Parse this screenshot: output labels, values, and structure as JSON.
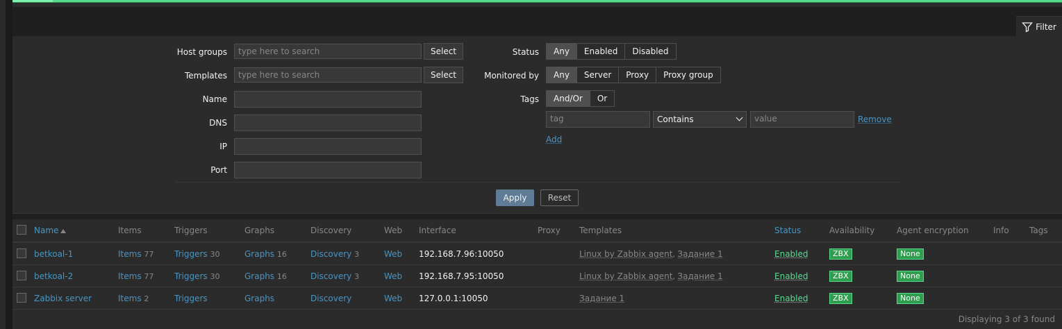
{
  "filter_tab": {
    "label": "Filter",
    "icon": "filter-icon"
  },
  "filter": {
    "host_groups": {
      "label": "Host groups",
      "placeholder": "type here to search",
      "select": "Select"
    },
    "templates": {
      "label": "Templates",
      "placeholder": "type here to search",
      "select": "Select"
    },
    "name": {
      "label": "Name",
      "value": ""
    },
    "dns": {
      "label": "DNS",
      "value": ""
    },
    "ip": {
      "label": "IP",
      "value": ""
    },
    "port": {
      "label": "Port",
      "value": ""
    },
    "status": {
      "label": "Status",
      "options": [
        "Any",
        "Enabled",
        "Disabled"
      ],
      "selected": "Any"
    },
    "monitored_by": {
      "label": "Monitored by",
      "options": [
        "Any",
        "Server",
        "Proxy",
        "Proxy group"
      ],
      "selected": "Any"
    },
    "tags": {
      "label": "Tags",
      "options": [
        "And/Or",
        "Or"
      ],
      "selected": "And/Or",
      "row": {
        "tag_placeholder": "tag",
        "operator": "Contains",
        "value_placeholder": "value",
        "remove": "Remove"
      },
      "add": "Add"
    },
    "apply": "Apply",
    "reset": "Reset"
  },
  "table": {
    "headers": {
      "name": "Name",
      "items": "Items",
      "triggers": "Triggers",
      "graphs": "Graphs",
      "discovery": "Discovery",
      "web": "Web",
      "interface": "Interface",
      "proxy": "Proxy",
      "templates": "Templates",
      "status": "Status",
      "availability": "Availability",
      "agent_encryption": "Agent encryption",
      "info": "Info",
      "tags": "Tags"
    },
    "rows": [
      {
        "name": "betkoal-1",
        "items": "Items",
        "items_count": "77",
        "triggers": "Triggers",
        "triggers_count": "30",
        "graphs": "Graphs",
        "graphs_count": "16",
        "discovery": "Discovery",
        "discovery_count": "3",
        "web": "Web",
        "interface": "192.168.7.96:10050",
        "templates": [
          "Linux by Zabbix agent",
          "Задание 1"
        ],
        "status": "Enabled",
        "availability": "ZBX",
        "encryption": "None"
      },
      {
        "name": "betkoal-2",
        "items": "Items",
        "items_count": "77",
        "triggers": "Triggers",
        "triggers_count": "30",
        "graphs": "Graphs",
        "graphs_count": "16",
        "discovery": "Discovery",
        "discovery_count": "3",
        "web": "Web",
        "interface": "192.168.7.95:10050",
        "templates": [
          "Linux by Zabbix agent",
          "Задание 1"
        ],
        "status": "Enabled",
        "availability": "ZBX",
        "encryption": "None"
      },
      {
        "name": "Zabbix server",
        "items": "Items",
        "items_count": "2",
        "triggers": "Triggers",
        "triggers_count": "",
        "graphs": "Graphs",
        "graphs_count": "",
        "discovery": "Discovery",
        "discovery_count": "",
        "web": "Web",
        "interface": "127.0.0.1:10050",
        "templates": [
          "Задание 1"
        ],
        "status": "Enabled",
        "availability": "ZBX",
        "encryption": "None"
      }
    ],
    "footer": "Displaying 3 of 3 found"
  },
  "colors": {
    "accent_blue": "#4796c4",
    "status_green": "#59db8f",
    "badge_green": "#2f9f4f"
  }
}
